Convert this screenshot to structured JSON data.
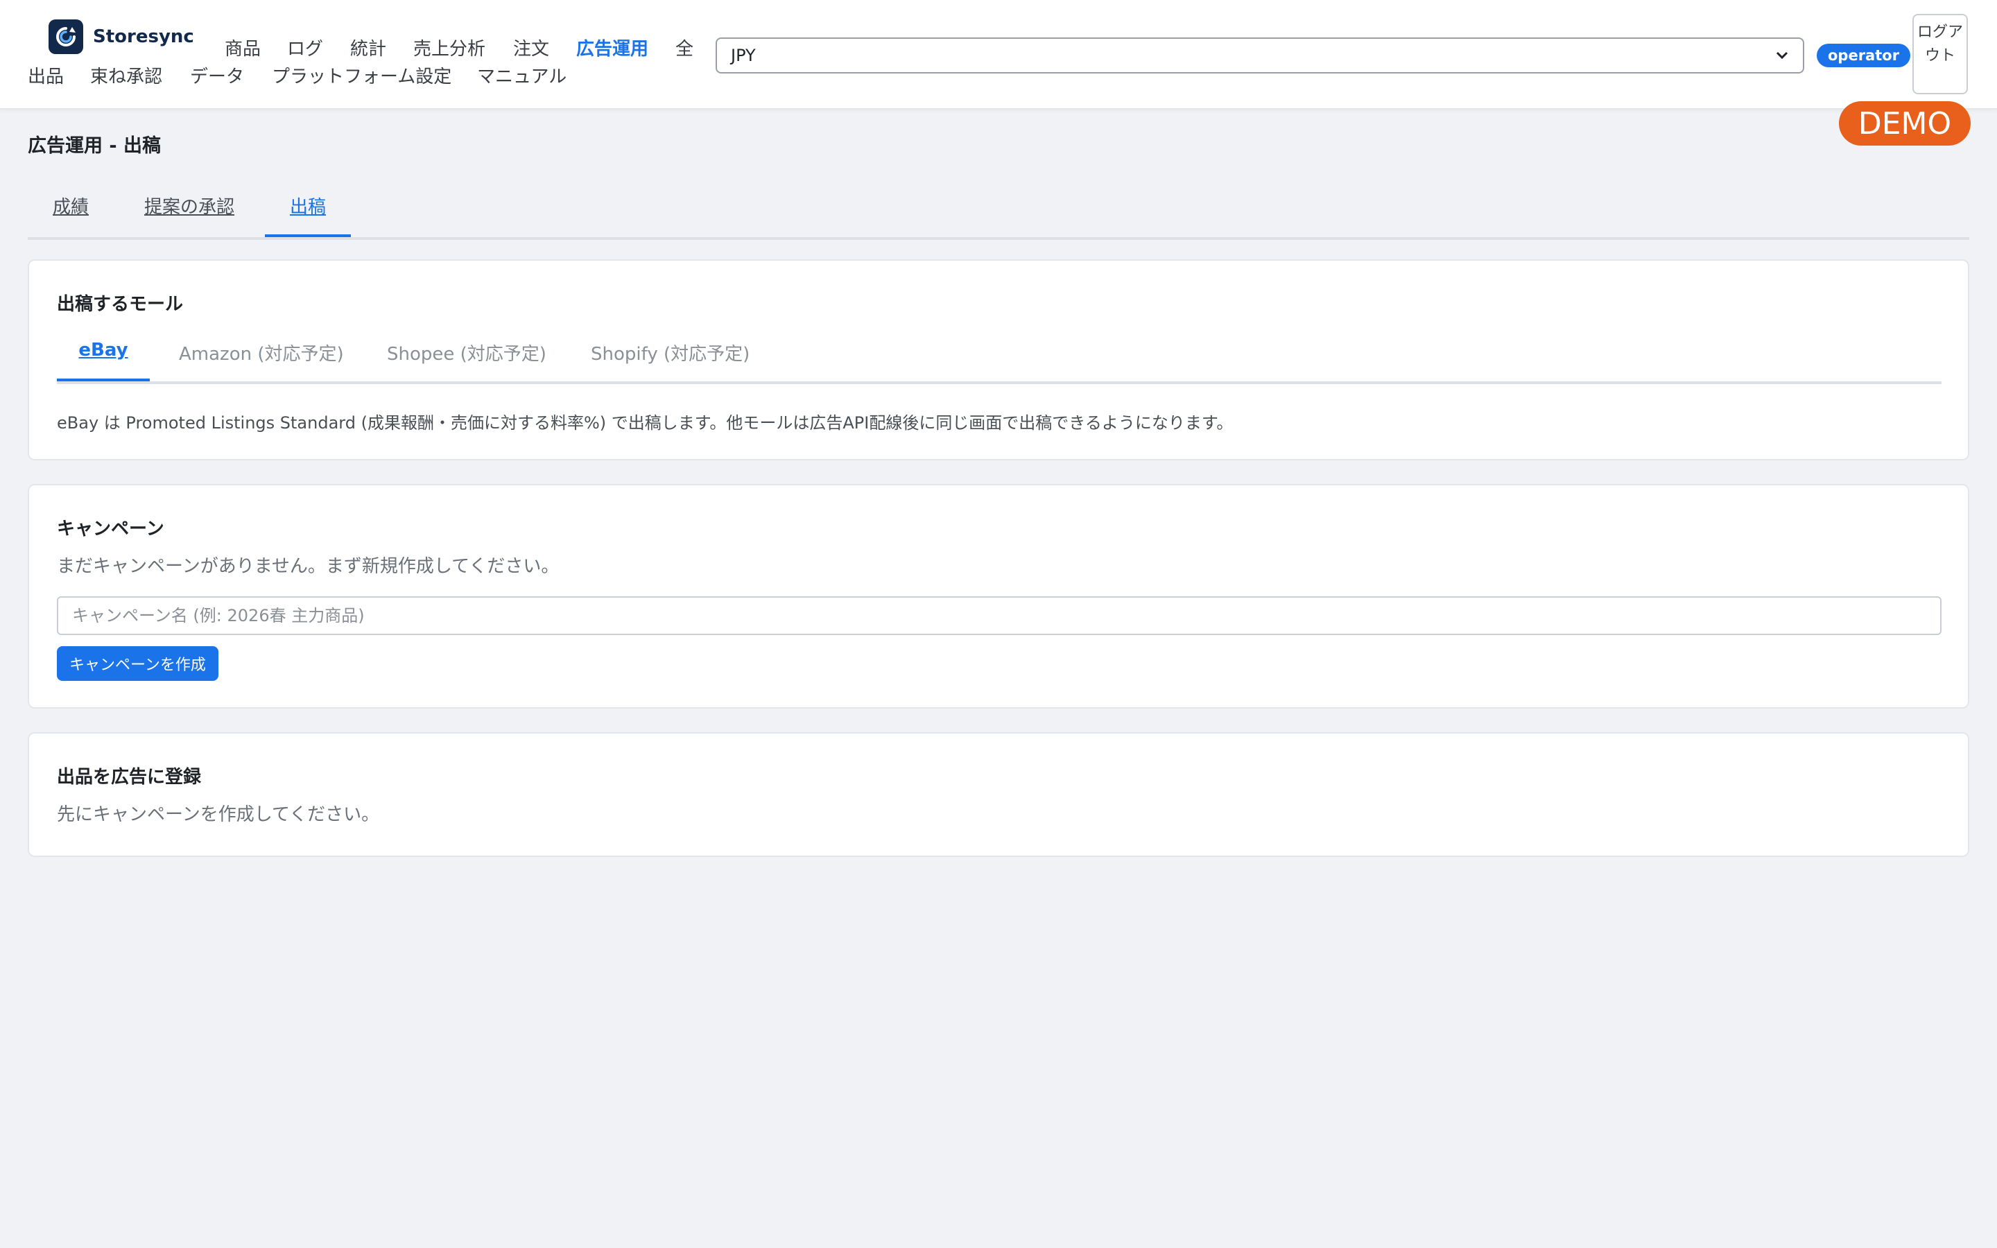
{
  "header": {
    "brand": "Storesync",
    "nav": [
      {
        "label": "商品",
        "active": false
      },
      {
        "label": "ログ",
        "active": false
      },
      {
        "label": "統計",
        "active": false
      },
      {
        "label": "売上分析",
        "active": false
      },
      {
        "label": "注文",
        "active": false
      },
      {
        "label": "広告運用",
        "active": true
      },
      {
        "label": "全",
        "active": false
      },
      {
        "label": "出品",
        "active": false
      },
      {
        "label": "束ね承認",
        "active": false
      },
      {
        "label": "データ",
        "active": false
      },
      {
        "label": "プラットフォーム設定",
        "active": false
      },
      {
        "label": "マニュアル",
        "active": false
      }
    ],
    "currency_value": "JPY",
    "role_badge": "operator",
    "logout_label": "ログアウト",
    "demo_badge": "DEMO"
  },
  "page": {
    "title": "広告運用 - 出稿",
    "tabs": [
      {
        "label": "成績",
        "active": false
      },
      {
        "label": "提案の承認",
        "active": false
      },
      {
        "label": "出稿",
        "active": true
      }
    ]
  },
  "mall_card": {
    "title": "出稿するモール",
    "tabs": [
      {
        "label": "eBay",
        "active": true
      },
      {
        "label": "Amazon (対応予定)",
        "active": false
      },
      {
        "label": "Shopee (対応予定)",
        "active": false
      },
      {
        "label": "Shopify (対応予定)",
        "active": false
      }
    ],
    "note": "eBay は Promoted Listings Standard (成果報酬・売価に対する料率%) で出稿します。他モールは広告API配線後に同じ画面で出稿できるようになります。"
  },
  "campaign_card": {
    "title": "キャンペーン",
    "empty_message": "まだキャンペーンがありません。まず新規作成してください。",
    "name_placeholder": "キャンペーン名 (例: 2026春 主力商品)",
    "create_button": "キャンペーンを作成"
  },
  "register_card": {
    "title": "出品を広告に登録",
    "message": "先にキャンペーンを作成してください。"
  },
  "colors": {
    "accent": "#1a73e8",
    "demo": "#e8601c",
    "background": "#f0f2f5",
    "brand_dark": "#13294b"
  }
}
